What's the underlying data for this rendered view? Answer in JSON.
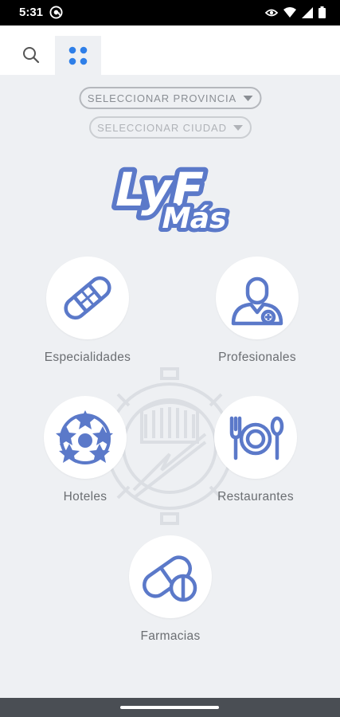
{
  "status_bar": {
    "time": "5:31",
    "icons": [
      "at-sign-icon",
      "eye-icon",
      "wifi-icon",
      "signal-icon",
      "battery-icon"
    ]
  },
  "toolbar": {
    "search_icon": "search-icon",
    "grid_icon": "grid-icon",
    "active_color": "#2f7fe8"
  },
  "filters": {
    "province_label": "SELECCIONAR PROVINCIA",
    "city_label": "SELECCIONAR CIUDAD"
  },
  "logo": {
    "line1": "LyF",
    "line2": "Más",
    "color": "#5b79c9"
  },
  "categories": [
    {
      "label": "Especialidades",
      "icon": "bandage-icon"
    },
    {
      "label": "Profesionales",
      "icon": "doctor-icon"
    },
    {
      "label": "Hoteles",
      "icon": "stars-icon"
    },
    {
      "label": "Restaurantes",
      "icon": "cutlery-plate-icon"
    },
    {
      "label": "Farmacias",
      "icon": "pills-icon"
    }
  ],
  "colors": {
    "accent": "#5b79c9",
    "background": "#eef0f3"
  }
}
